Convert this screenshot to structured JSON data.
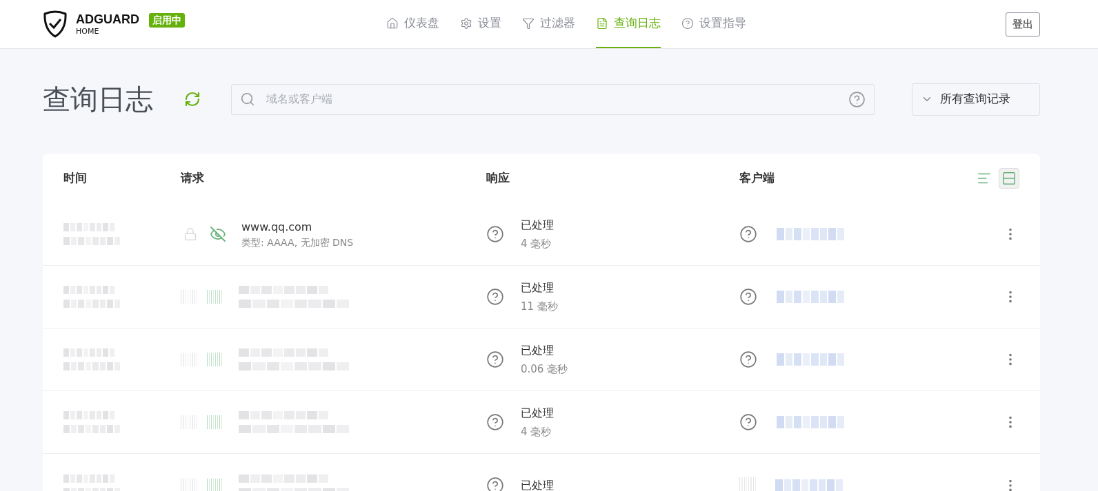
{
  "brand": {
    "name": "ADGUARD",
    "sub": "HOME",
    "status": "启用中"
  },
  "nav": [
    {
      "label": "仪表盘",
      "kind": "home",
      "selected": false
    },
    {
      "label": "设置",
      "kind": "gear",
      "selected": false
    },
    {
      "label": "过滤器",
      "kind": "filter",
      "selected": false
    },
    {
      "label": "查询日志",
      "kind": "file",
      "selected": true
    },
    {
      "label": "设置指导",
      "kind": "help",
      "selected": false
    }
  ],
  "logout": "登出",
  "page_title": "查询日志",
  "search": {
    "placeholder": "域名或客户端"
  },
  "filter_dropdown": "所有查询记录",
  "table": {
    "columns": [
      "时间",
      "请求",
      "响应",
      "客户端"
    ],
    "view_toggles": [
      {
        "kind": "compact",
        "selected": false
      },
      {
        "kind": "default",
        "selected": true
      }
    ],
    "rows": [
      {
        "request": {
          "domain": "www.qq.com",
          "detail": "类型: AAAA, 无加密 DNS"
        },
        "status": "已处理",
        "elapsed": "4 毫秒"
      },
      {
        "status": "已处理",
        "elapsed": "11 毫秒"
      },
      {
        "status": "已处理",
        "elapsed": "0.06 毫秒"
      },
      {
        "status": "已处理",
        "elapsed": "4 毫秒"
      },
      {
        "status": "已处理"
      }
    ]
  }
}
